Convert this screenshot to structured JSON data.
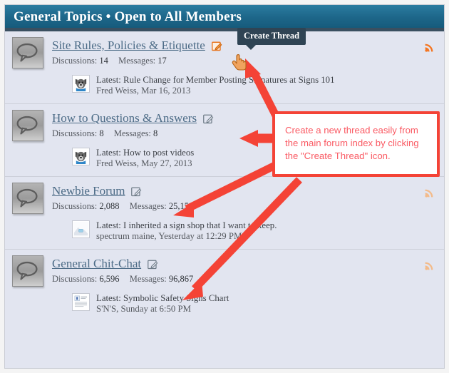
{
  "header": {
    "title": "General Topics • Open to All Members"
  },
  "tooltip": {
    "label": "Create Thread"
  },
  "callout": {
    "text": "Create a new thread easily from the main forum index by clicking the \"Create Thread\" icon.",
    "border_color": "#f44336",
    "text_color": "#fa5a63"
  },
  "labels": {
    "discussions": "Discussions:",
    "messages": "Messages:",
    "latest": "Latest:"
  },
  "colors": {
    "header_gradient_top": "#2b7ca0",
    "header_gradient_bottom": "#165b7c",
    "header_underline": "#3a4f60",
    "row_background": "#e2e5f0",
    "row_divider": "#cdd0da",
    "forum_title": "#4c6b86",
    "rss_orange": "#f47521",
    "tooltip_background": "#2f4454"
  },
  "forums": [
    {
      "title": "Site Rules, Policies & Etiquette",
      "discussions": "14",
      "messages": "17",
      "create_thread_icon": "edit-icon",
      "create_thread_icon_state": "hovered",
      "rss_icon": "rss-icon",
      "node_icon": "speech-bubble-icon",
      "last_post": {
        "avatar_icon": "dog-avatar-icon",
        "title": "Rule Change for Member Posting Signatures at Signs 101",
        "author": "Fred Weiss",
        "date": "Mar 16, 2013"
      }
    },
    {
      "title": "How to Questions & Answers",
      "discussions": "8",
      "messages": "8",
      "create_thread_icon": "edit-icon",
      "create_thread_icon_state": "normal",
      "rss_icon": "rss-icon",
      "node_icon": "speech-bubble-icon",
      "last_post": {
        "avatar_icon": "dog-avatar-icon",
        "title": "How to post videos",
        "author": "Fred Weiss",
        "date": "May 27, 2013"
      }
    },
    {
      "title": "Newbie Forum",
      "discussions": "2,088",
      "messages": "25,159",
      "create_thread_icon": "edit-icon",
      "create_thread_icon_state": "normal",
      "rss_icon": "rss-icon",
      "node_icon": "speech-bubble-icon",
      "last_post": {
        "avatar_icon": "photo-avatar-icon",
        "title": "I inherited a sign shop that I want to keep.",
        "author": "spectrum maine",
        "date": "Yesterday at 12:29 PM"
      }
    },
    {
      "title": "General Chit-Chat",
      "discussions": "6,596",
      "messages": "96,867",
      "create_thread_icon": "edit-icon",
      "create_thread_icon_state": "normal",
      "rss_icon": "rss-icon",
      "node_icon": "speech-bubble-icon",
      "last_post": {
        "avatar_icon": "document-avatar-icon",
        "title": "Symbolic Safety Signs Chart",
        "author": "S'N'S",
        "date": "Sunday at 6:50 PM"
      }
    }
  ]
}
